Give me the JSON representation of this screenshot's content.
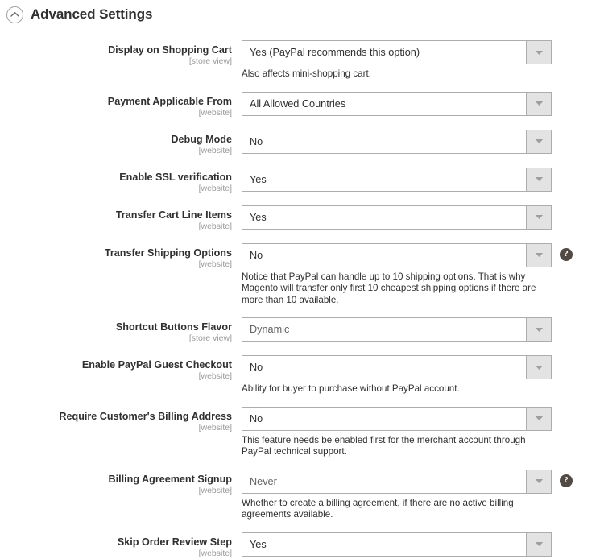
{
  "section": {
    "title": "Advanced Settings",
    "collapse_icon": "chevron-up-circle-icon"
  },
  "fields": [
    {
      "label": "Display on Shopping Cart",
      "scope": "[store view]",
      "value": "Yes (PayPal recommends this option)",
      "note": "Also affects mini-shopping cart.",
      "help": false,
      "muted": false
    },
    {
      "label": "Payment Applicable From",
      "scope": "[website]",
      "value": "All Allowed Countries",
      "note": "",
      "help": false,
      "muted": false
    },
    {
      "label": "Debug Mode",
      "scope": "[website]",
      "value": "No",
      "note": "",
      "help": false,
      "muted": false
    },
    {
      "label": "Enable SSL verification",
      "scope": "[website]",
      "value": "Yes",
      "note": "",
      "help": false,
      "muted": false
    },
    {
      "label": "Transfer Cart Line Items",
      "scope": "[website]",
      "value": "Yes",
      "note": "",
      "help": false,
      "muted": false
    },
    {
      "label": "Transfer Shipping Options",
      "scope": "[website]",
      "value": "No",
      "note": "Notice that PayPal can handle up to 10 shipping options. That is why Magento will transfer only first 10 cheapest shipping options if there are more than 10 available.",
      "help": true,
      "muted": false
    },
    {
      "label": "Shortcut Buttons Flavor",
      "scope": "[store view]",
      "value": "Dynamic",
      "note": "",
      "help": false,
      "muted": true
    },
    {
      "label": "Enable PayPal Guest Checkout",
      "scope": "[website]",
      "value": "No",
      "note": "Ability for buyer to purchase without PayPal account.",
      "help": false,
      "muted": false
    },
    {
      "label": "Require Customer's Billing Address",
      "scope": "[website]",
      "value": "No",
      "note": "This feature needs be enabled first for the merchant account through PayPal technical support.",
      "help": false,
      "muted": false
    },
    {
      "label": "Billing Agreement Signup",
      "scope": "[website]",
      "value": "Never",
      "note": "Whether to create a billing agreement, if there are no active billing agreements available.",
      "help": true,
      "muted": true
    },
    {
      "label": "Skip Order Review Step",
      "scope": "[website]",
      "value": "Yes",
      "note": "",
      "help": false,
      "muted": false
    }
  ],
  "icons": {
    "dropdown_arrow": "chevron-down-icon",
    "help": "help-circle-icon",
    "help_glyph": "?"
  },
  "colors": {
    "text": "#303030",
    "scope_text": "#9a9a9a",
    "border": "#adadad",
    "arrow_bg": "#e3e3e3",
    "help_bg": "#514943"
  }
}
